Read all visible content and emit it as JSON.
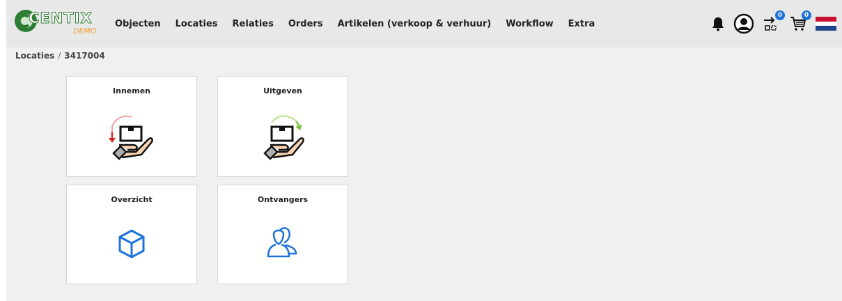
{
  "brand": {
    "name": "CENTIX",
    "edition": "DEMO"
  },
  "nav": [
    {
      "label": "Objecten"
    },
    {
      "label": "Locaties"
    },
    {
      "label": "Relaties"
    },
    {
      "label": "Orders"
    },
    {
      "label": "Artikelen (verkoop & verhuur)"
    },
    {
      "label": "Workflow"
    },
    {
      "label": "Extra"
    }
  ],
  "header_icons": {
    "notifications": "bell-icon",
    "user": "user-avatar-icon",
    "transfers": {
      "icon": "transfer-icon",
      "count": "0"
    },
    "cart": {
      "icon": "cart-icon",
      "count": "0"
    },
    "language": "netherlands-flag-icon"
  },
  "breadcrumb": {
    "parent": "Locaties",
    "separator": "/",
    "current": "3417004"
  },
  "tiles": [
    {
      "title": "Innemen",
      "icon": "hand-box-receive-icon"
    },
    {
      "title": "Uitgeven",
      "icon": "hand-box-issue-icon"
    },
    {
      "title": "Overzicht",
      "icon": "cube-icon"
    },
    {
      "title": "Ontvangers",
      "icon": "users-icon"
    }
  ],
  "colors": {
    "accent_blue": "#1e73d8",
    "brand_green": "#2e7d32",
    "brand_orange": "#f2a03a",
    "receive_arrow": "#d62828",
    "issue_arrow": "#7cc242"
  }
}
